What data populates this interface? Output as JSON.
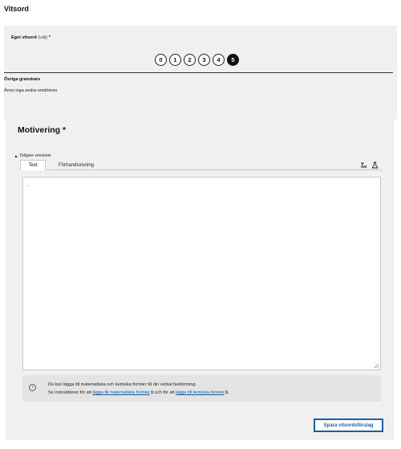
{
  "page": {
    "title": "Vitsord"
  },
  "grading": {
    "own_label": "Eget vitsord",
    "own_label_hint": "(välj)",
    "required_marker": " *",
    "scale": [
      "0",
      "1",
      "2",
      "3",
      "4",
      "5"
    ],
    "selected": "5",
    "other_reviewers_title": "Övriga granskare",
    "other_reviewers_empty": "Ännu inga andra omdömen"
  },
  "motivation": {
    "title": "Motivering *",
    "previous_versions": "Tidigare versioner",
    "tabs": [
      {
        "label": "Text",
        "active": true
      },
      {
        "label": "Förhandsvisning",
        "active": false
      }
    ],
    "toolbar_icons": [
      "math-formula-icon",
      "chemistry-formula-icon"
    ],
    "editor_value": "-",
    "info": {
      "icon": "info-icon",
      "line1": "Du kan lägga till matematiska och kemiska formler till din verbal bedömning.",
      "line2_prefix": "Se instruktioner för att ",
      "link_math": "lägga till matematiska formler",
      "line2_middle": " och för att ",
      "link_chem": "lägga till kemiska formler",
      "line2_suffix": "."
    }
  },
  "actions": {
    "save_label": "Spara vitsordsförslag"
  },
  "colors": {
    "accent": "#1d5ea8",
    "link": "#0b5da8",
    "panel": "#f0f0f0",
    "selected_grade": "#111111"
  }
}
